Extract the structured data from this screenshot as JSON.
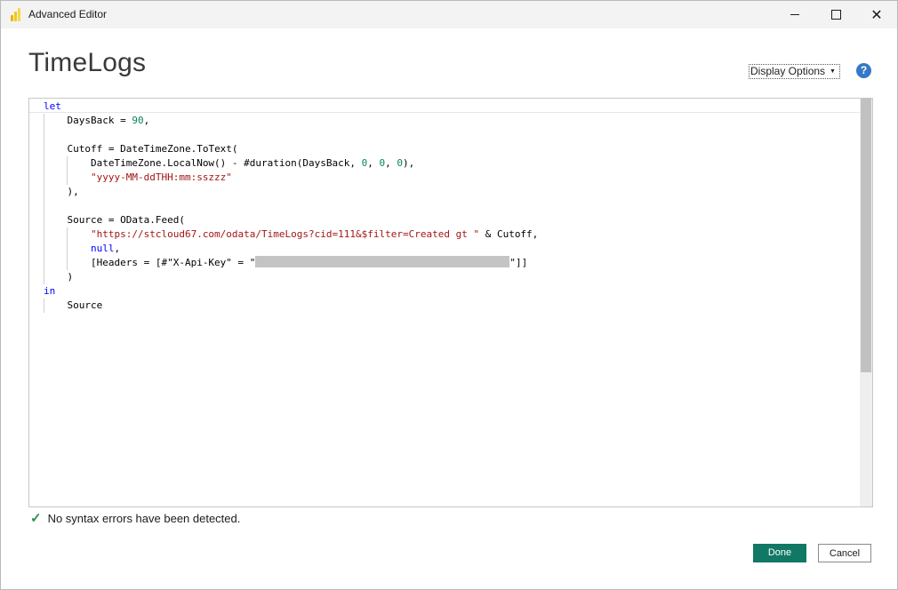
{
  "window": {
    "title": "Advanced Editor",
    "controls": {
      "minimize": "minimize",
      "maximize": "maximize",
      "close": "✕"
    }
  },
  "header": {
    "query_name": "TimeLogs",
    "display_options": "Display Options",
    "help": "?"
  },
  "editor": {
    "lines": [
      {
        "indent": 0,
        "tokens": [
          {
            "t": "let",
            "c": "kw"
          }
        ]
      },
      {
        "indent": 1,
        "tokens": [
          {
            "t": "DaysBack = "
          },
          {
            "t": "90",
            "c": "num"
          },
          {
            "t": ","
          }
        ]
      },
      {
        "indent": 0,
        "tokens": []
      },
      {
        "indent": 1,
        "tokens": [
          {
            "t": "Cutoff = DateTimeZone.ToText("
          }
        ]
      },
      {
        "indent": 2,
        "tokens": [
          {
            "t": "DateTimeZone.LocalNow() - #duration(DaysBack, "
          },
          {
            "t": "0",
            "c": "num"
          },
          {
            "t": ", "
          },
          {
            "t": "0",
            "c": "num"
          },
          {
            "t": ", "
          },
          {
            "t": "0",
            "c": "num"
          },
          {
            "t": "),"
          }
        ]
      },
      {
        "indent": 2,
        "tokens": [
          {
            "t": "\"yyyy-MM-ddTHH:mm:sszzz\"",
            "c": "str"
          }
        ]
      },
      {
        "indent": 1,
        "tokens": [
          {
            "t": "),"
          }
        ]
      },
      {
        "indent": 0,
        "tokens": []
      },
      {
        "indent": 1,
        "tokens": [
          {
            "t": "Source = OData.Feed("
          }
        ]
      },
      {
        "indent": 2,
        "tokens": [
          {
            "t": "\"https://stcloud67.com/odata/TimeLogs?cid=111&$filter=Created gt \"",
            "c": "str"
          },
          {
            "t": " & Cutoff,"
          }
        ]
      },
      {
        "indent": 2,
        "tokens": [
          {
            "t": "null",
            "c": "kw"
          },
          {
            "t": ","
          }
        ]
      },
      {
        "indent": 2,
        "tokens": [
          {
            "t": "[Headers = [#\"X-Api-Key\" = \""
          },
          {
            "t": "",
            "c": "redact"
          },
          {
            "t": "\"]]"
          }
        ]
      },
      {
        "indent": 1,
        "tokens": [
          {
            "t": ")"
          }
        ]
      },
      {
        "indent": 0,
        "tokens": [
          {
            "t": "in",
            "c": "kw"
          }
        ]
      },
      {
        "indent": 1,
        "tokens": [
          {
            "t": "Source"
          }
        ]
      }
    ]
  },
  "status": {
    "icon": "checkmark-icon",
    "message": "No syntax errors have been detected."
  },
  "footer": {
    "done_label": "Done",
    "cancel_label": "Cancel"
  },
  "colors": {
    "keyword": "#0000ff",
    "number": "#098658",
    "string": "#a31515",
    "done_button": "#117865",
    "help_icon": "#3478c6",
    "check": "#2f8f4e"
  }
}
